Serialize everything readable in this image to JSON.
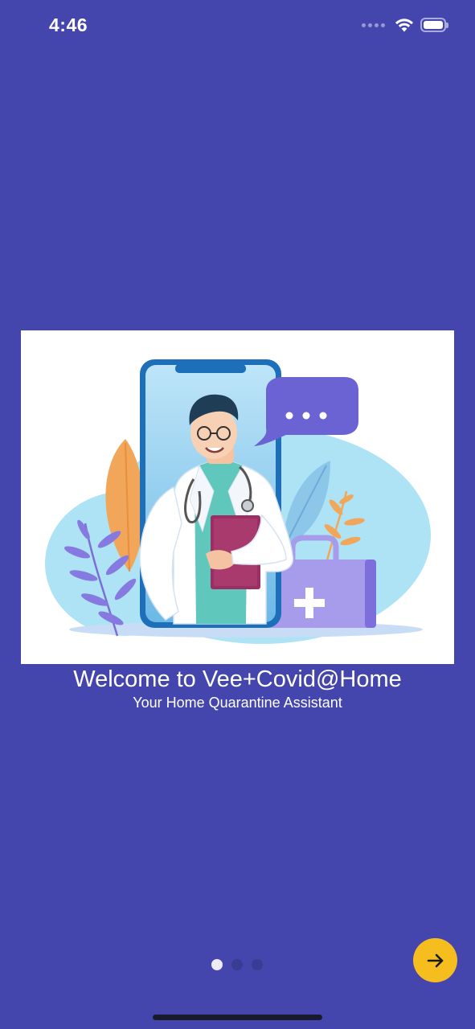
{
  "status_bar": {
    "time": "4:46",
    "icons": [
      "signal-dots-icon",
      "wifi-icon",
      "battery-icon"
    ]
  },
  "onboarding": {
    "illustration": "doctor-on-phone-illustration",
    "title": "Welcome to Vee+Covid@Home",
    "subtitle": "Your Home Quarantine Assistant",
    "page_count": 3,
    "current_page": 1,
    "next_icon": "arrow-right-icon"
  },
  "colors": {
    "background": "#4546AD",
    "accent": "#F5BE1E",
    "dot_active": "#ECECF7",
    "dot_inactive": "#3A3B93"
  }
}
